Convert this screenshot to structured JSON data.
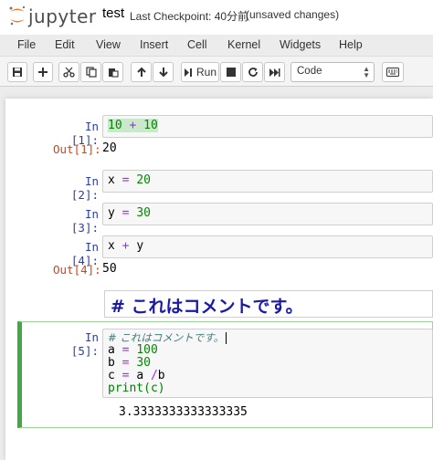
{
  "header": {
    "logo_text": "jupyter",
    "notebook_name": "test",
    "checkpoint": "Last Checkpoint: 40分前",
    "autosave_status": "(unsaved changes)"
  },
  "menubar": {
    "items": [
      "File",
      "Edit",
      "View",
      "Insert",
      "Cell",
      "Kernel",
      "Widgets",
      "Help"
    ]
  },
  "toolbar": {
    "run_label": "Run",
    "cell_type": "Code",
    "icons": [
      "save-icon",
      "plus-icon",
      "cut-icon",
      "copy-icon",
      "paste-icon",
      "arrow-up-icon",
      "arrow-down-icon",
      "step-forward-icon",
      "stop-icon",
      "restart-icon",
      "fast-forward-icon",
      "keyboard-icon"
    ]
  },
  "cells": {
    "c1": {
      "prompt_in": "In [1]:",
      "code": [
        "10",
        "+",
        "10"
      ],
      "prompt_out": "Out[1]:",
      "output": "20"
    },
    "c2": {
      "prompt_in": "In [2]:",
      "code": [
        "x",
        "=",
        "20"
      ]
    },
    "c3": {
      "prompt_in": "In [3]:",
      "code": [
        "y",
        "=",
        "30"
      ]
    },
    "c4": {
      "prompt_in": "In [4]:",
      "code": [
        "x",
        "+",
        "y"
      ],
      "prompt_out": "Out[4]:",
      "output": "50"
    },
    "md": {
      "text": "# これはコメントです。"
    },
    "c5": {
      "prompt_in": "In [5]:",
      "line1": "# これはコメントです。",
      "line2": [
        "a",
        "=",
        "100"
      ],
      "line3": [
        "b",
        "=",
        "30"
      ],
      "line4": [
        "c",
        "=",
        "a",
        "/",
        "b"
      ],
      "line5": "print(c)",
      "output": "3.3333333333333335"
    }
  }
}
